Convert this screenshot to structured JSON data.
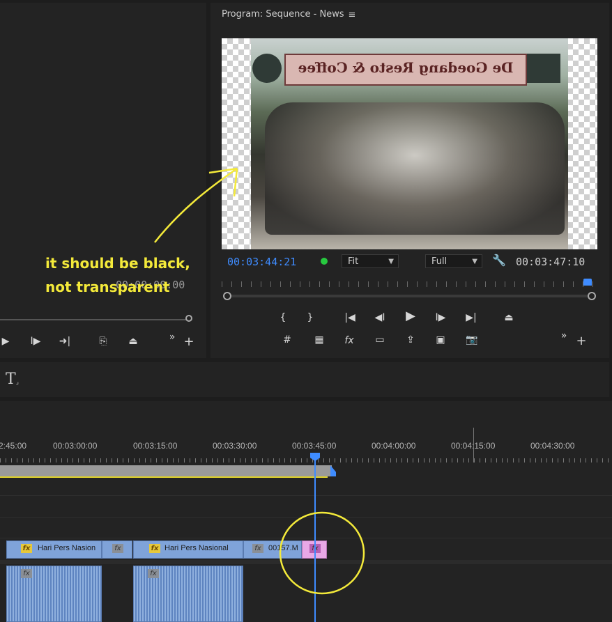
{
  "program_monitor": {
    "title": "Program: Sequence - News",
    "menu_icon": "hamburger-icon",
    "banner_text": "De Goedang Resto & Coffee",
    "playhead_timecode": "00:03:44:21",
    "duration_timecode": "00:03:47:10",
    "zoom_select": "Fit",
    "quality_select": "Full",
    "status_dot_color": "#27c93f"
  },
  "source_monitor": {
    "timecode": "00:00:00:00"
  },
  "tools": {
    "type_tool_icon": "type-tool-icon"
  },
  "timeline": {
    "ruler_labels": [
      "2:45:00",
      "00:03:00:00",
      "00:03:15:00",
      "00:03:30:00",
      "00:03:45:00",
      "00:04:00:00",
      "00:04:15:00",
      "00:04:30:00"
    ],
    "clips": [
      {
        "label": "Hari Pers Nasion"
      },
      {
        "label": "Hari Pers Nasional"
      },
      {
        "label": "00157.M"
      }
    ]
  },
  "annotation": {
    "line1": "it should be black,",
    "line2": "not transparent"
  },
  "colors": {
    "accent_blue": "#3f8cff",
    "clip_blue": "#7fa3d9",
    "annotation_yellow": "#f4ea3a"
  }
}
